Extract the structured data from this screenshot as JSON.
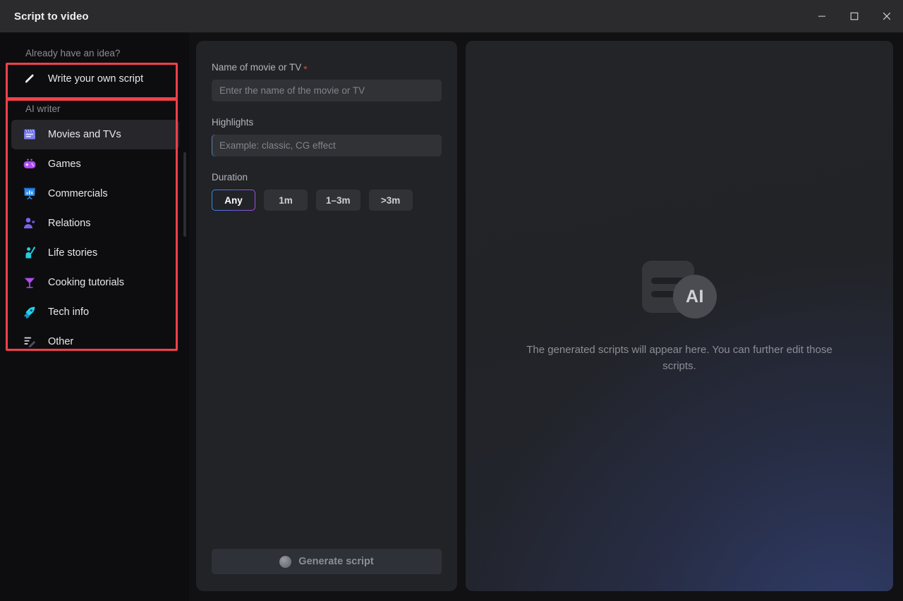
{
  "window": {
    "title": "Script to video",
    "controls": [
      {
        "name": "minimize",
        "glyph": "─"
      },
      {
        "name": "maximize",
        "glyph": "☐"
      },
      {
        "name": "close",
        "glyph": "✕"
      }
    ]
  },
  "sidebar": {
    "idea_section_label": "Already have an idea?",
    "write_own": {
      "label": "Write your own script",
      "icon": "pencil-icon"
    },
    "ai_writer_label": "AI writer",
    "items": [
      {
        "label": "Movies and TVs",
        "icon": "clapperboard-icon",
        "selected": true
      },
      {
        "label": "Games",
        "icon": "gamepad-icon",
        "selected": false
      },
      {
        "label": "Commercials",
        "icon": "presentation-chart-icon",
        "selected": false
      },
      {
        "label": "Relations",
        "icon": "person-heart-icon",
        "selected": false
      },
      {
        "label": "Life stories",
        "icon": "person-waving-icon",
        "selected": false
      },
      {
        "label": "Cooking tutorials",
        "icon": "cocktail-glass-icon",
        "selected": false
      },
      {
        "label": "Tech info",
        "icon": "rocket-icon",
        "selected": false
      },
      {
        "label": "Other",
        "icon": "document-pen-icon",
        "selected": false
      }
    ]
  },
  "form": {
    "name_label": "Name of movie or TV",
    "name_required_mark": "*",
    "name_value": "",
    "name_placeholder": "Enter the name of the movie or TV",
    "highlights_label": "Highlights",
    "highlights_value": "",
    "highlights_placeholder": "Example: classic, CG effect",
    "duration_label": "Duration",
    "duration_options": [
      {
        "label": "Any",
        "selected": true
      },
      {
        "label": "1m",
        "selected": false
      },
      {
        "label": "1–3m",
        "selected": false
      },
      {
        "label": ">3m",
        "selected": false
      }
    ],
    "generate_label": "Generate script",
    "generate_disabled": true
  },
  "output": {
    "ai_badge_text": "AI",
    "empty_text": "The generated scripts will appear here. You can further edit those scripts."
  },
  "colors": {
    "accent_gradient_start": "#2d8fe8",
    "accent_gradient_end": "#a14fe0",
    "required_mark": "#e8463c",
    "annotation_box": "#f2404a",
    "titlebar_bg": "#2b2b2d",
    "sidebar_bg": "#0d0d10",
    "panel_bg": "#222327",
    "input_bg": "#313236"
  }
}
